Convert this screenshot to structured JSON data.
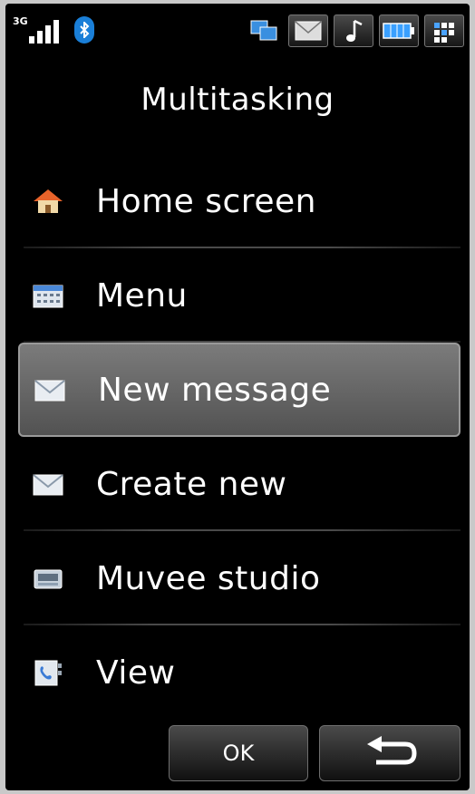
{
  "status_bar": {
    "network_label": "3G",
    "icons": [
      "multitasking-icon",
      "message-icon",
      "music-icon",
      "battery-icon",
      "grid-icon"
    ],
    "bluetooth_color": "#1a7fd8",
    "battery_color": "#3aa0ff"
  },
  "title": "Multitasking",
  "menu": {
    "items": [
      {
        "label": "Home screen",
        "icon": "home-icon"
      },
      {
        "label": "Menu",
        "icon": "menu-grid-icon"
      },
      {
        "label": "New message",
        "icon": "envelope-icon",
        "selected": true
      },
      {
        "label": "Create new",
        "icon": "envelope-icon"
      },
      {
        "label": "Muvee studio",
        "icon": "muvee-studio-icon"
      },
      {
        "label": "View",
        "icon": "contact-card-icon"
      }
    ]
  },
  "buttons": {
    "ok_label": "OK",
    "back_icon": "back-arrow-icon"
  }
}
